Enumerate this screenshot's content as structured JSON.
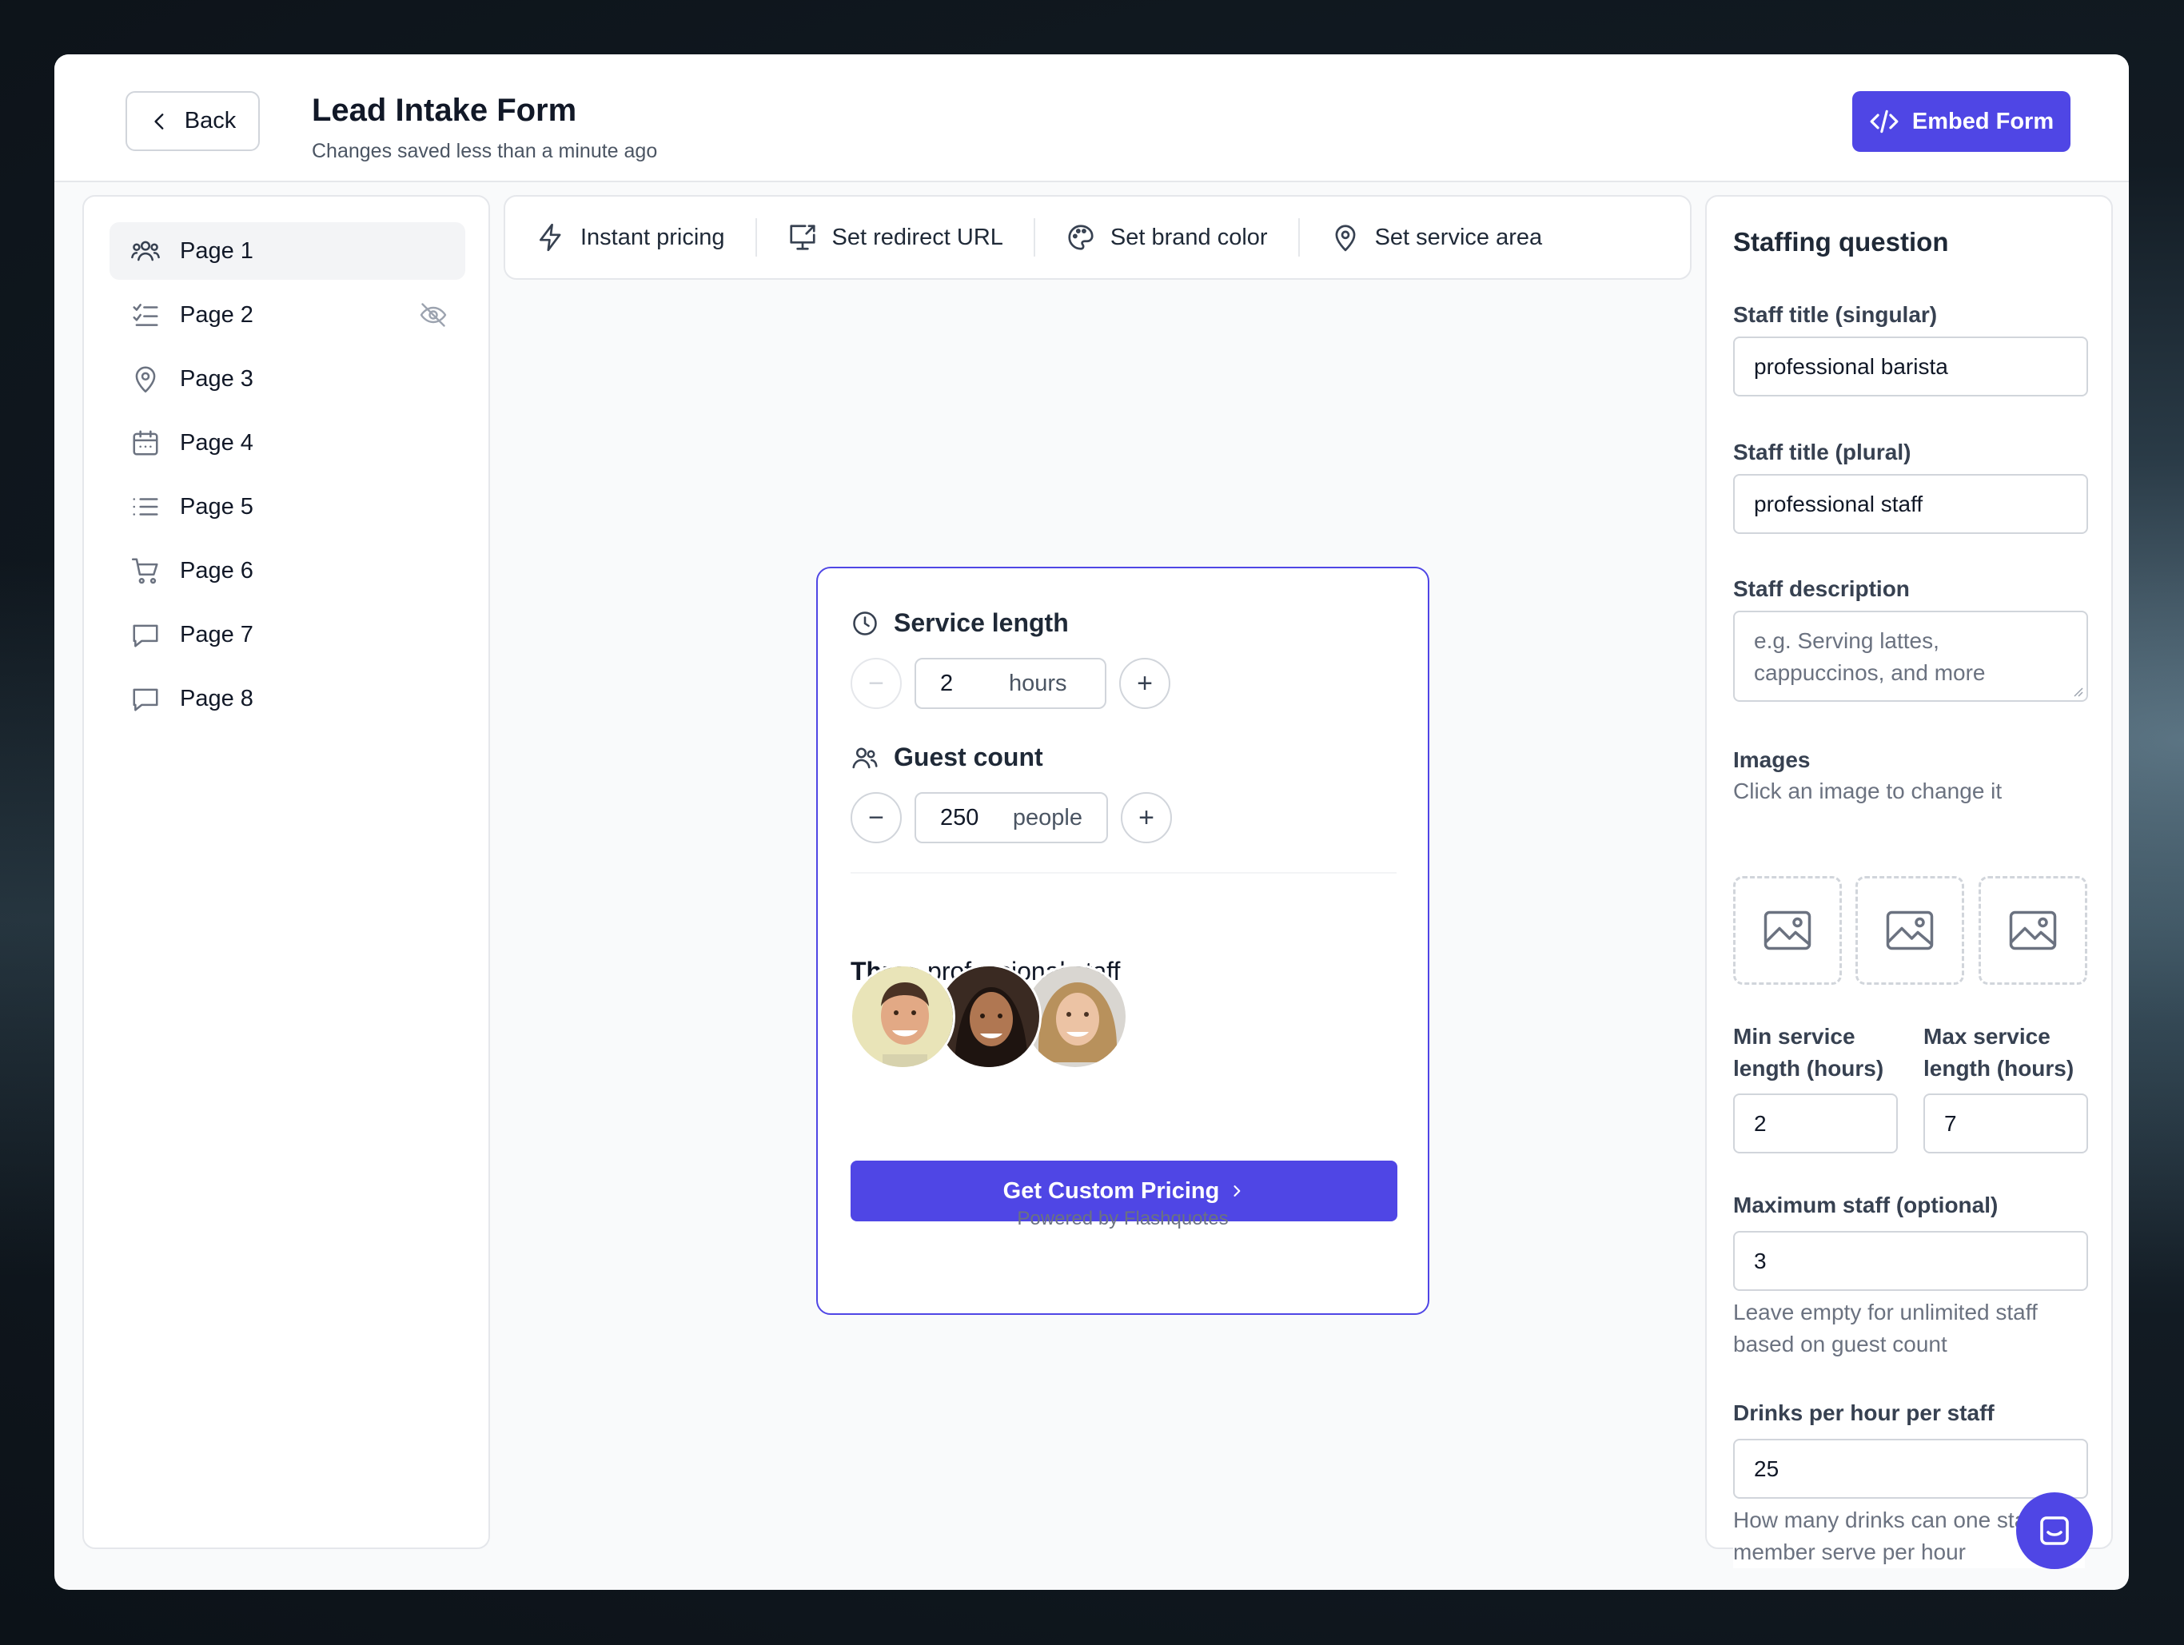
{
  "header": {
    "back_label": "Back",
    "title": "Lead Intake Form",
    "subtitle": "Changes saved less than a minute ago",
    "embed_label": "Embed Form"
  },
  "sidebar": {
    "items": [
      {
        "label": "Page 1",
        "icon": "users-icon",
        "active": true
      },
      {
        "label": "Page 2",
        "icon": "checklist-icon",
        "hidden_icon": "eye-off-icon"
      },
      {
        "label": "Page 3",
        "icon": "map-pin-icon"
      },
      {
        "label": "Page 4",
        "icon": "calendar-icon"
      },
      {
        "label": "Page 5",
        "icon": "list-icon"
      },
      {
        "label": "Page 6",
        "icon": "cart-icon"
      },
      {
        "label": "Page 7",
        "icon": "chat-bubble-icon"
      },
      {
        "label": "Page 8",
        "icon": "chat-bubble-icon"
      }
    ]
  },
  "toolbar": {
    "instant_pricing": "Instant pricing",
    "redirect_url": "Set redirect URL",
    "brand_color": "Set brand color",
    "service_area": "Set service area"
  },
  "preview": {
    "service_length_title": "Service length",
    "service_length_value": "2",
    "service_length_unit": "hours",
    "guest_count_title": "Guest count",
    "guest_count_value": "250",
    "guest_count_unit": "people",
    "staff_count_word": "Three",
    "staff_label": "professional staff",
    "cta_label": "Get Custom Pricing",
    "powered_by": "Powered by Flashquotes"
  },
  "settings": {
    "title": "Staffing question",
    "staff_title_singular_label": "Staff title (singular)",
    "staff_title_singular_value": "professional barista",
    "staff_title_plural_label": "Staff title (plural)",
    "staff_title_plural_value": "professional staff",
    "staff_description_label": "Staff description",
    "staff_description_placeholder": "e.g. Serving lattes, cappuccinos, and more",
    "images_label": "Images",
    "images_help": "Click an image to change it",
    "min_service_label": "Min service length (hours)",
    "min_service_value": "2",
    "max_service_label": "Max service length (hours)",
    "max_service_value": "7",
    "max_staff_label": "Maximum staff (optional)",
    "max_staff_value": "3",
    "max_staff_help": "Leave empty for unlimited staff based on guest count",
    "drinks_label": "Drinks per hour per staff",
    "drinks_value": "25",
    "drinks_help": "How many drinks can one staff member serve per hour"
  },
  "colors": {
    "accent": "#4f46e5",
    "border": "#e5e7eb"
  }
}
